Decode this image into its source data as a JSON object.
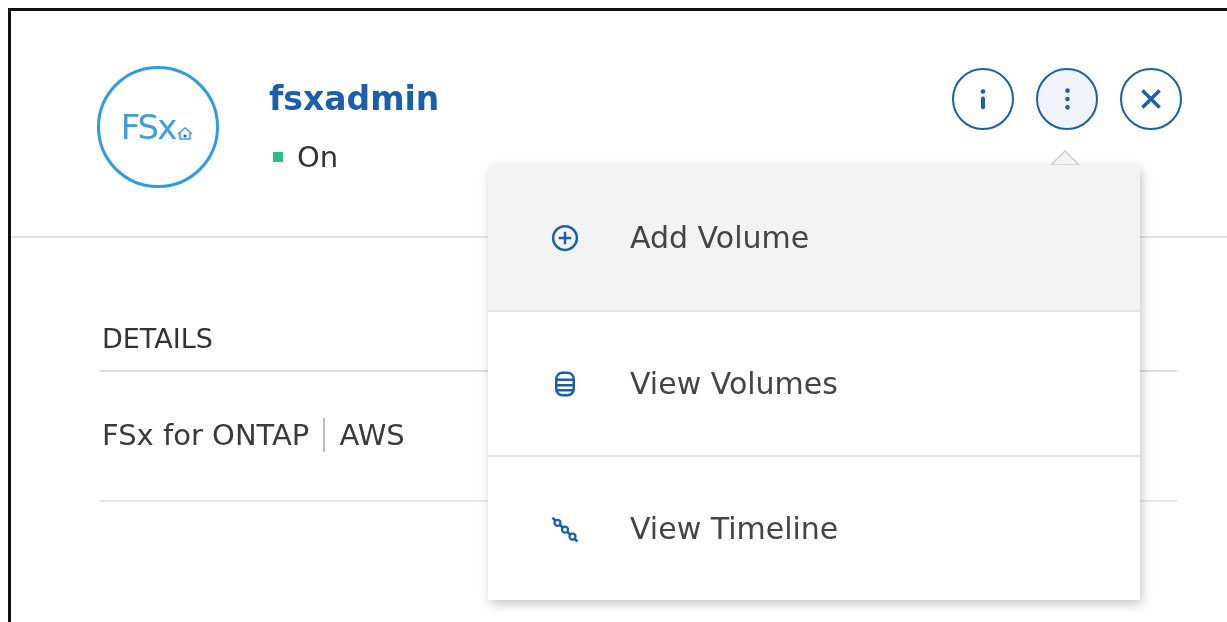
{
  "header": {
    "logo_text": "FSx",
    "title": "fsxadmin",
    "status": {
      "label": "On",
      "on": true
    }
  },
  "actions": [
    {
      "kind": "info",
      "open": false
    },
    {
      "kind": "more",
      "open": true
    },
    {
      "kind": "close",
      "open": false
    }
  ],
  "details": {
    "heading": "DETAILS",
    "values": [
      "FSx for ONTAP",
      "AWS"
    ]
  },
  "menu": [
    {
      "kind": "add",
      "label": "Add Volume",
      "selected": true
    },
    {
      "kind": "volumes",
      "label": "View Volumes",
      "selected": false
    },
    {
      "kind": "timeline",
      "label": "View Timeline",
      "selected": false
    }
  ]
}
